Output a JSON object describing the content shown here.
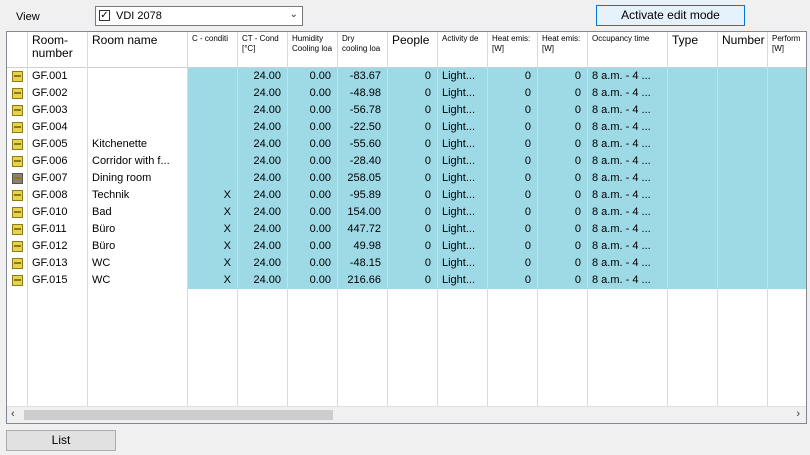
{
  "view": {
    "label": "View",
    "checkbox": "✓",
    "selected": "VDI 2078"
  },
  "edit_button": "Activate edit mode",
  "list_button": "List",
  "columns": [
    {
      "label": "Room-\nnumber",
      "size": "big"
    },
    {
      "label": "Room name",
      "size": "big"
    },
    {
      "label": "C - conditi",
      "size": "small"
    },
    {
      "label": "CT - Cond\n[°C]",
      "size": "small"
    },
    {
      "label": "Humidity\nCooling loa",
      "size": "small"
    },
    {
      "label": "Dry\ncooling loa",
      "size": "small"
    },
    {
      "label": "People",
      "size": "big"
    },
    {
      "label": "Activity de",
      "size": "small"
    },
    {
      "label": "Heat emis:\n[W]",
      "size": "small"
    },
    {
      "label": "Heat emis:\n[W]",
      "size": "small"
    },
    {
      "label": "Occupancy time",
      "size": "small"
    },
    {
      "label": "Type",
      "size": "big"
    },
    {
      "label": "Number",
      "size": "big"
    },
    {
      "label": "Perform\n[W]",
      "size": "small"
    }
  ],
  "rows": [
    {
      "num": "GF.001",
      "name": "",
      "c": "",
      "ct": "24.00",
      "hum": "0.00",
      "dry": "-83.67",
      "people": "0",
      "act": "Light...",
      "he1": "0",
      "he2": "0",
      "occ": "8 a.m. - 4 ...",
      "icon": "light"
    },
    {
      "num": "GF.002",
      "name": "",
      "c": "",
      "ct": "24.00",
      "hum": "0.00",
      "dry": "-48.98",
      "people": "0",
      "act": "Light...",
      "he1": "0",
      "he2": "0",
      "occ": "8 a.m. - 4 ...",
      "icon": "light"
    },
    {
      "num": "GF.003",
      "name": "",
      "c": "",
      "ct": "24.00",
      "hum": "0.00",
      "dry": "-56.78",
      "people": "0",
      "act": "Light...",
      "he1": "0",
      "he2": "0",
      "occ": "8 a.m. - 4 ...",
      "icon": "light"
    },
    {
      "num": "GF.004",
      "name": "",
      "c": "",
      "ct": "24.00",
      "hum": "0.00",
      "dry": "-22.50",
      "people": "0",
      "act": "Light...",
      "he1": "0",
      "he2": "0",
      "occ": "8 a.m. - 4 ...",
      "icon": "light"
    },
    {
      "num": "GF.005",
      "name": "Kitchenette",
      "c": "",
      "ct": "24.00",
      "hum": "0.00",
      "dry": "-55.60",
      "people": "0",
      "act": "Light...",
      "he1": "0",
      "he2": "0",
      "occ": "8 a.m. - 4 ...",
      "icon": "light"
    },
    {
      "num": "GF.006",
      "name": "Corridor with f...",
      "c": "",
      "ct": "24.00",
      "hum": "0.00",
      "dry": "-28.40",
      "people": "0",
      "act": "Light...",
      "he1": "0",
      "he2": "0",
      "occ": "8 a.m. - 4 ...",
      "icon": "light"
    },
    {
      "num": "GF.007",
      "name": "Dining room",
      "c": "",
      "ct": "24.00",
      "hum": "0.00",
      "dry": "258.05",
      "people": "0",
      "act": "Light...",
      "he1": "0",
      "he2": "0",
      "occ": "8 a.m. - 4 ...",
      "icon": "dark"
    },
    {
      "num": "GF.008",
      "name": "Technik",
      "c": "X",
      "ct": "24.00",
      "hum": "0.00",
      "dry": "-95.89",
      "people": "0",
      "act": "Light...",
      "he1": "0",
      "he2": "0",
      "occ": "8 a.m. - 4 ...",
      "icon": "light"
    },
    {
      "num": "GF.010",
      "name": "Bad",
      "c": "X",
      "ct": "24.00",
      "hum": "0.00",
      "dry": "154.00",
      "people": "0",
      "act": "Light...",
      "he1": "0",
      "he2": "0",
      "occ": "8 a.m. - 4 ...",
      "icon": "light"
    },
    {
      "num": "GF.011",
      "name": "Büro",
      "c": "X",
      "ct": "24.00",
      "hum": "0.00",
      "dry": "447.72",
      "people": "0",
      "act": "Light...",
      "he1": "0",
      "he2": "0",
      "occ": "8 a.m. - 4 ...",
      "icon": "light"
    },
    {
      "num": "GF.012",
      "name": "Büro",
      "c": "X",
      "ct": "24.00",
      "hum": "0.00",
      "dry": "49.98",
      "people": "0",
      "act": "Light...",
      "he1": "0",
      "he2": "0",
      "occ": "8 a.m. - 4 ...",
      "icon": "light"
    },
    {
      "num": "GF.013",
      "name": "WC",
      "c": "X",
      "ct": "24.00",
      "hum": "0.00",
      "dry": "-48.15",
      "people": "0",
      "act": "Light...",
      "he1": "0",
      "he2": "0",
      "occ": "8 a.m. - 4 ...",
      "icon": "light"
    },
    {
      "num": "GF.015",
      "name": "WC",
      "c": "X",
      "ct": "24.00",
      "hum": "0.00",
      "dry": "216.66",
      "people": "0",
      "act": "Light...",
      "he1": "0",
      "he2": "0",
      "occ": "8 a.m. - 4 ...",
      "icon": "light"
    }
  ],
  "scroll": {
    "left": "‹",
    "right": "›"
  },
  "colors": {
    "row_highlight": "#9ed9e6",
    "accent_border": "#0078d7"
  }
}
